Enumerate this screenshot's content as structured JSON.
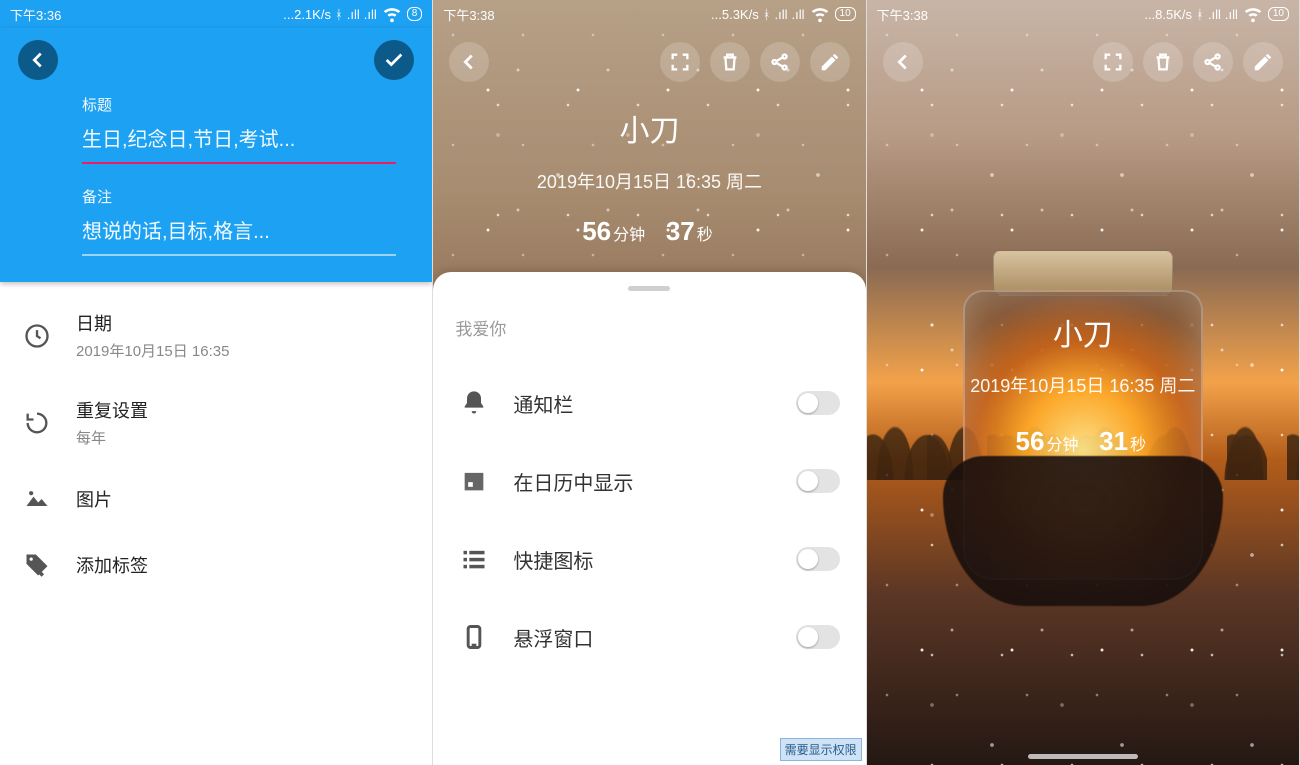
{
  "screen1": {
    "status": {
      "time": "下午3:36",
      "net": "...2.1K/s",
      "battery": "8"
    },
    "title_label": "标题",
    "title_placeholder": "生日,纪念日,节日,考试...",
    "note_label": "备注",
    "note_placeholder": "想说的话,目标,格言...",
    "items": {
      "date": {
        "label": "日期",
        "value": "2019年10月15日 16:35"
      },
      "repeat": {
        "label": "重复设置",
        "value": "每年"
      },
      "image": {
        "label": "图片"
      },
      "tag": {
        "label": "添加标签"
      }
    }
  },
  "screen2": {
    "status": {
      "time": "下午3:38",
      "net": "...5.3K/s",
      "battery": "10"
    },
    "hero": {
      "title": "小刀",
      "date": "2019年10月15日 16:35 周二",
      "cd_min_n": "56",
      "cd_min_u": "分钟",
      "cd_sec_n": "37",
      "cd_sec_u": "秒"
    },
    "sheet": {
      "sub": "我爱你",
      "rows": {
        "notify": "通知栏",
        "calendar": "在日历中显示",
        "shortcut": "快捷图标",
        "float": "悬浮窗口"
      },
      "perm_tag": "需要显示权限"
    }
  },
  "screen3": {
    "status": {
      "time": "下午3:38",
      "net": "...8.5K/s",
      "battery": "10"
    },
    "hero": {
      "title": "小刀",
      "date": "2019年10月15日 16:35 周二",
      "cd_min_n": "56",
      "cd_min_u": "分钟",
      "cd_sec_n": "31",
      "cd_sec_u": "秒"
    }
  }
}
